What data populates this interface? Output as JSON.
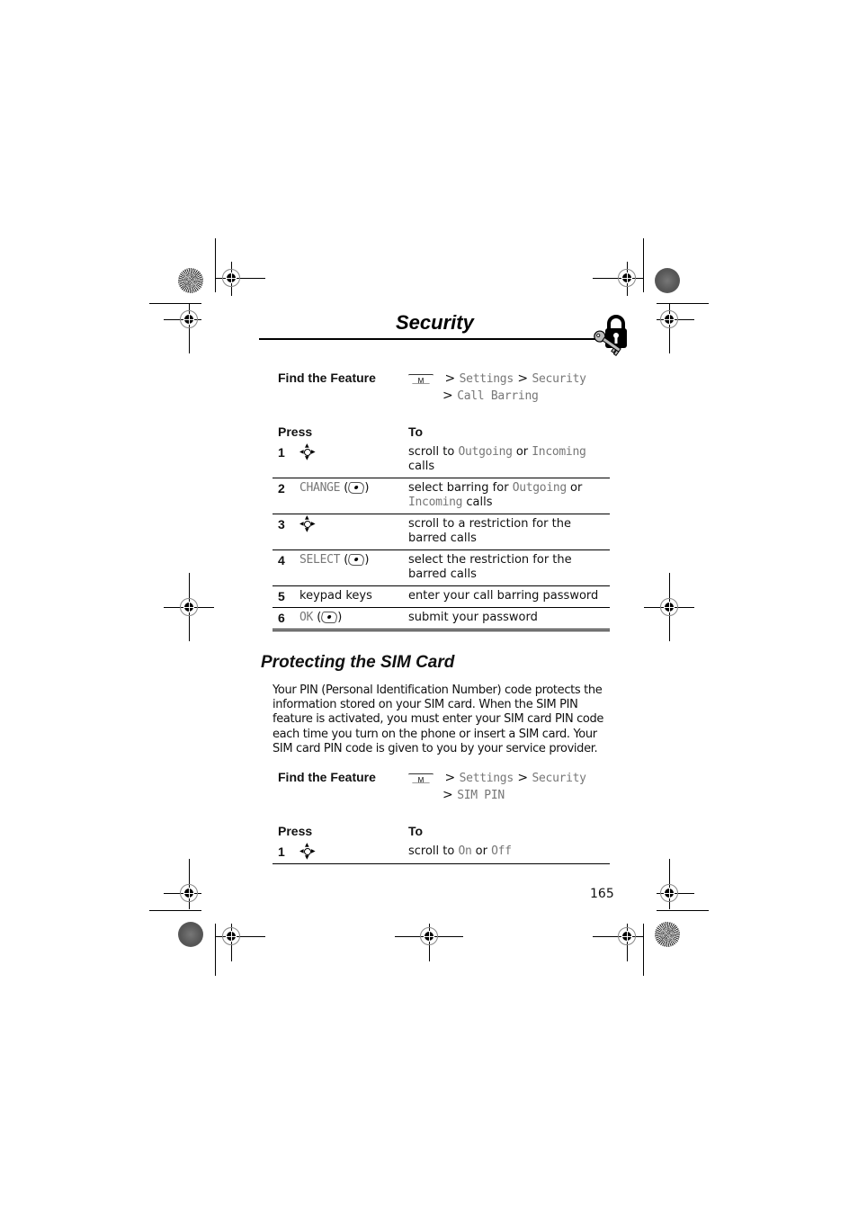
{
  "header": {
    "title": "Security",
    "icon": "lock-with-key-icon"
  },
  "call_barring": {
    "find_feature_label": "Find the Feature",
    "menu_key_letter": "M",
    "path_line1": [
      {
        "sep": ">",
        "item": "Settings"
      },
      {
        "sep": ">",
        "item": "Security"
      }
    ],
    "path_line2": [
      {
        "sep": ">",
        "item": "Call Barring"
      }
    ],
    "table_headers": {
      "press": "Press",
      "to": "To"
    },
    "steps": [
      {
        "num": "1",
        "press_icon": "nav-key-icon",
        "press_text": "",
        "to": [
          {
            "t": "scroll to "
          },
          {
            "m": "Outgoing"
          },
          {
            "t": " or "
          },
          {
            "m": "Incoming"
          },
          {
            "t": " calls"
          }
        ]
      },
      {
        "num": "2",
        "press_key": "CHANGE",
        "press_icon": "soft-key-icon",
        "to": [
          {
            "t": "select barring for "
          },
          {
            "m": "Outgoing"
          },
          {
            "t": " or "
          },
          {
            "m": "Incoming"
          },
          {
            "t": " calls"
          }
        ]
      },
      {
        "num": "3",
        "press_icon": "nav-key-icon",
        "press_text": "",
        "to": [
          {
            "t": "scroll to a restriction for the barred calls"
          }
        ]
      },
      {
        "num": "4",
        "press_key": "SELECT",
        "press_icon": "soft-key-icon",
        "to": [
          {
            "t": "select the restriction for the barred calls"
          }
        ]
      },
      {
        "num": "5",
        "press_text": "keypad keys",
        "to": [
          {
            "t": "enter your call barring password"
          }
        ]
      },
      {
        "num": "6",
        "press_key": "OK",
        "press_icon": "soft-key-icon",
        "to": [
          {
            "t": "submit your password"
          }
        ]
      }
    ]
  },
  "sim_section": {
    "title": "Protecting the SIM Card",
    "paragraph": "Your PIN (Personal Identification Number) code protects the information stored on your SIM card. When the SIM PIN feature is activated, you must enter your SIM card PIN code each time you turn on the phone or insert a SIM card. Your SIM card PIN code is given to you by your service provider.",
    "find_feature_label": "Find the Feature",
    "menu_key_letter": "M",
    "path_line1": [
      {
        "sep": ">",
        "item": "Settings"
      },
      {
        "sep": ">",
        "item": "Security"
      }
    ],
    "path_line2": [
      {
        "sep": ">",
        "item": "SIM PIN"
      }
    ],
    "table_headers": {
      "press": "Press",
      "to": "To"
    },
    "steps": [
      {
        "num": "1",
        "press_icon": "nav-key-icon",
        "to": [
          {
            "t": "scroll to "
          },
          {
            "m": "On"
          },
          {
            "t": " or "
          },
          {
            "m": "Off"
          }
        ]
      }
    ]
  },
  "footer": {
    "page_number": "165"
  }
}
